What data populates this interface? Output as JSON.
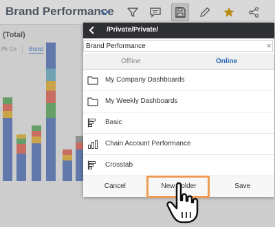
{
  "toolbar": {
    "title": "Brand Performance",
    "icons": [
      "chevron-down-icon",
      "filter-icon",
      "comment-icon",
      "save-icon",
      "edit-icon",
      "star-icon",
      "share-icon"
    ],
    "star_color": "#d4a017"
  },
  "background_chart": {
    "title": "(Total)",
    "tabs": [
      "Pk Cn",
      "Brand"
    ],
    "selected_tab": "Brand"
  },
  "dialog": {
    "path": "/Private/Private/",
    "name_value": "Brand Performance",
    "tabs": [
      {
        "label": "Offline",
        "selected": false
      },
      {
        "label": "Online",
        "selected": true
      }
    ],
    "items": [
      {
        "label": "My Company Dashboards",
        "icon": "folder-icon"
      },
      {
        "label": "My Weekly Dashboards",
        "icon": "folder-icon"
      },
      {
        "label": "Basic",
        "icon": "gantt-icon"
      },
      {
        "label": "Chain Account Performance",
        "icon": "bar-chart-icon"
      },
      {
        "label": "Crosstab",
        "icon": "gantt-icon"
      }
    ],
    "buttons": {
      "cancel": "Cancel",
      "new_folder": "New Folder",
      "save": "Save"
    },
    "header_color": "#2d2f33",
    "active_tab_color": "#2a66b0"
  },
  "annotation": {
    "highlight_color": "#ef9a53",
    "pointer": "hand-pointer-icon"
  }
}
